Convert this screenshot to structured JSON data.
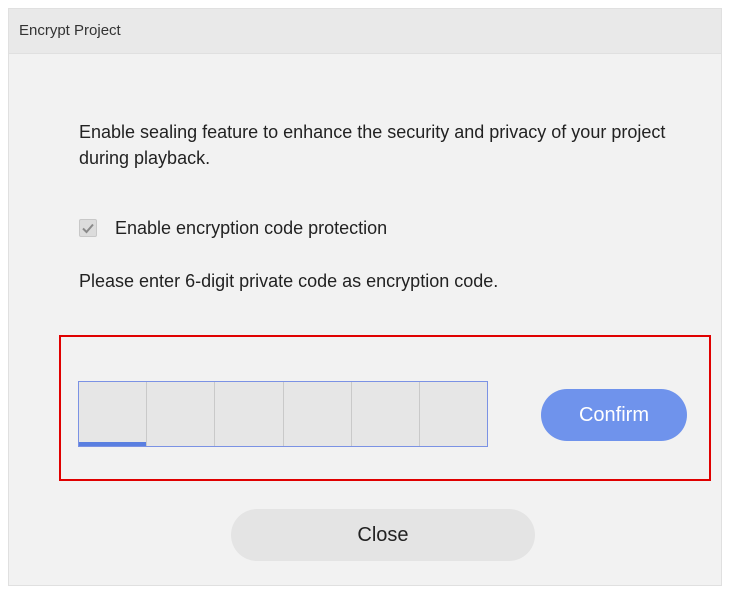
{
  "dialog": {
    "title": "Encrypt Project",
    "description": "Enable sealing feature to enhance the security and privacy of your project during playback.",
    "checkbox": {
      "label": "Enable encryption code protection",
      "checked": true,
      "icon": "checkmark-icon"
    },
    "instruction": "Please enter 6-digit private code as encryption code.",
    "code_digits": [
      "",
      "",
      "",
      "",
      "",
      ""
    ],
    "confirm_label": "Confirm",
    "close_label": "Close"
  },
  "colors": {
    "accent": "#6f93ec",
    "highlight_border": "#e00000",
    "active_underline": "#5a7fe0"
  }
}
